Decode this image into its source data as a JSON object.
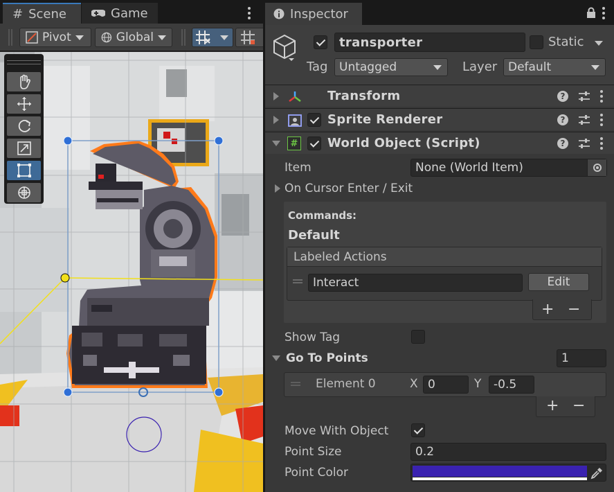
{
  "scene": {
    "tabs": [
      {
        "label": "Scene",
        "icon": "hash-icon"
      },
      {
        "label": "Game",
        "icon": "gamepad-icon"
      }
    ],
    "toolbar": {
      "pivot_label": "Pivot",
      "global_label": "Global"
    },
    "tools": [
      "hand-tool",
      "move-tool",
      "rotate-tool",
      "scale-tool",
      "rect-tool",
      "transform-tool"
    ],
    "selected_tool": "rect-tool"
  },
  "inspector": {
    "tab_label": "Inspector",
    "object": {
      "active": true,
      "name": "transporter",
      "static_label": "Static",
      "static": false,
      "tag_label": "Tag",
      "tag_value": "Untagged",
      "layer_label": "Layer",
      "layer_value": "Default"
    },
    "components": [
      {
        "title": "Transform",
        "expanded": false,
        "has_checkbox": false
      },
      {
        "title": "Sprite Renderer",
        "expanded": false,
        "has_checkbox": true,
        "enabled": true
      },
      {
        "title": "World Object (Script)",
        "expanded": true,
        "has_checkbox": true,
        "enabled": true
      }
    ],
    "world_object": {
      "item_label": "Item",
      "item_value": "None (World Item)",
      "cursor_label": "On Cursor Enter / Exit",
      "commands_label": "Commands:",
      "default_label": "Default",
      "labeled_actions_label": "Labeled Actions",
      "action_value": "Interact",
      "edit_label": "Edit",
      "plus": "+",
      "minus": "−",
      "show_tag_label": "Show Tag",
      "show_tag": false,
      "go_to_points_label": "Go To Points",
      "go_to_points_count": "1",
      "element_label": "Element 0",
      "x_label": "X",
      "x_value": "0",
      "y_label": "Y",
      "y_value": "-0.5",
      "move_with_object_label": "Move With Object",
      "move_with_object": true,
      "point_size_label": "Point Size",
      "point_size_value": "0.2",
      "point_color_label": "Point Color",
      "point_color": "#3a22b0"
    }
  },
  "colors": {
    "accent": "#3a79bb",
    "selection_outline": "#ff7a1a",
    "handle": "#2f6fd6",
    "pivot": "#f2e01a"
  }
}
